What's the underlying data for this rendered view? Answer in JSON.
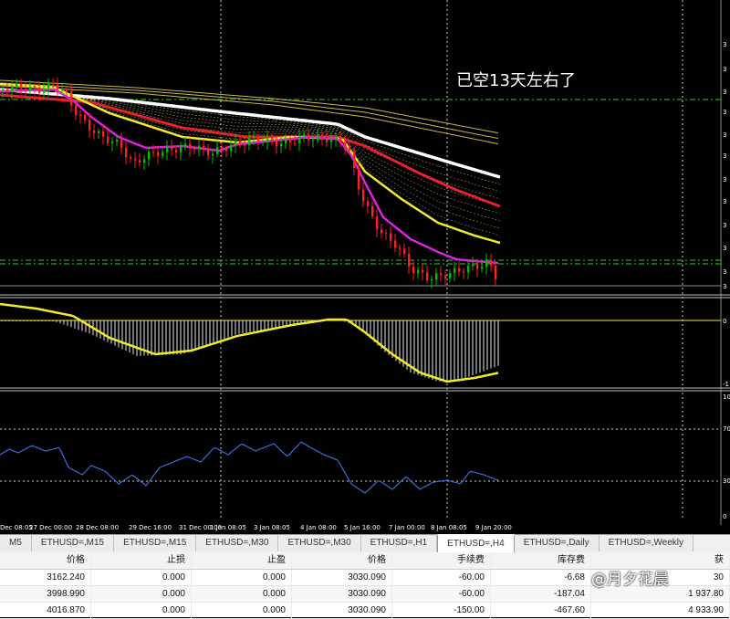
{
  "chart": {
    "annotation": "已空13天左右了",
    "x_labels": [
      "Dec 08:05",
      "27 Dec 00:00",
      "28 Dec 08:00",
      "29 Dec 16:00",
      "31 Dec 00:00",
      "1 Jan 08:05",
      "3 Jan 08:05",
      "4 Jan 08:00",
      "5 Jan 16:00",
      "7 Jan 00:00",
      "8 Jan 08:05",
      "9 Jan 20:00"
    ],
    "y_labels": [
      "3",
      "3",
      "3",
      "3",
      "3",
      "3",
      "3",
      "3",
      "3",
      "3",
      "3",
      "3",
      "3",
      "3",
      "2"
    ],
    "macd_labels": [
      "0",
      "-1"
    ],
    "rsi_labels": [
      "100",
      "70",
      "30",
      "0"
    ],
    "colors": {
      "bull_candle": "#00c000",
      "bear_candle": "#ff2020",
      "ma_white": "#ffffff",
      "ma_red": "#e8202c",
      "ma_yellow": "#f2ea28",
      "ma_magenta": "#e020e0",
      "ma_olive": "#c8b450",
      "level_line": "#22aa22",
      "rsi_line": "#3f6ad8",
      "macd_signal": "#f2ea28"
    }
  },
  "tabs": [
    {
      "label": "M5",
      "active": false
    },
    {
      "label": "ETHUSD=,M15",
      "active": false
    },
    {
      "label": "ETHUSD=,M15",
      "active": false
    },
    {
      "label": "ETHUSD=,M30",
      "active": false
    },
    {
      "label": "ETHUSD=,M30",
      "active": false
    },
    {
      "label": "ETHUSD=,H1",
      "active": false
    },
    {
      "label": "ETHUSD=,H4",
      "active": true
    },
    {
      "label": "ETHUSD=,Daily",
      "active": false
    },
    {
      "label": "ETHUSD=,Weekly",
      "active": false
    }
  ],
  "table": {
    "headers": [
      "价格",
      "止损",
      "止盈",
      "价格",
      "手续费",
      "库存费",
      "获"
    ],
    "rows": [
      [
        "3162.240",
        "0.000",
        "0.000",
        "3030.090",
        "-60.00",
        "-6.68",
        "30"
      ],
      [
        "3998.990",
        "0.000",
        "0.000",
        "3030.090",
        "-60.00",
        "-187.04",
        "1 937.80"
      ],
      [
        "4016.870",
        "0.000",
        "0.000",
        "3030.090",
        "-150.00",
        "-467.60",
        "4 933.90"
      ]
    ]
  },
  "watermark": "@月夕花晨"
}
